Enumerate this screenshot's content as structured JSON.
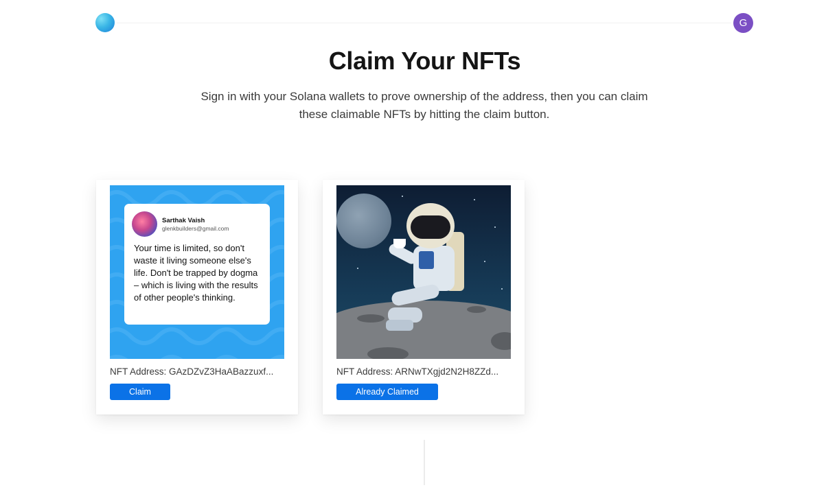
{
  "header": {
    "logo_icon": "app-logo-icon",
    "avatar_letter": "G"
  },
  "page": {
    "title": "Claim Your NFTs",
    "subtitle": "Sign in with your Solana wallets to prove ownership of the address, then you can claim these claimable NFTs by hitting the claim button."
  },
  "cards": [
    {
      "image": {
        "kind": "tweet",
        "name": "Sarthak Vaish",
        "handle": "glenkbuilders@gmail.com",
        "text": "Your time is limited, so don't waste it living someone else's life. Don't be trapped by dogma – which is living with the results of other people's thinking."
      },
      "address": "NFT Address: GAzDZvZ3HaABazzuxf...",
      "button_label": "Claim"
    },
    {
      "image": {
        "kind": "astronaut-illustration"
      },
      "address": "NFT Address: ARNwTXgjd2N2H8ZZd...",
      "button_label": "Already Claimed"
    }
  ],
  "colors": {
    "primary_button": "#0b72e7",
    "avatar": "#7b4fc4",
    "tweet_background": "#2fa3f0"
  }
}
